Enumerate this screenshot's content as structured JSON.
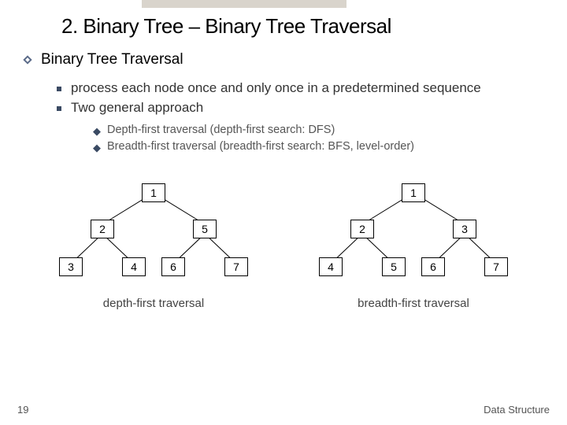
{
  "title": "2. Binary Tree – Binary Tree Traversal",
  "subtitle": "Binary Tree Traversal",
  "bullets": {
    "b1": "process each node once and only once in a predetermined sequence",
    "b2": "Two general approach"
  },
  "subbullets": {
    "s1": "Depth-first traversal (depth-first search: DFS)",
    "s2": "Breadth-first traversal (breadth-first search: BFS, level-order)"
  },
  "treeA_caption": "depth-first traversal",
  "treeB_caption": "breadth-first traversal",
  "page_number": "19",
  "footer": "Data Structure",
  "chart_data": [
    {
      "type": "tree",
      "name": "depth-first",
      "nodes": {
        "root": "1",
        "l": "2",
        "r": "5",
        "ll": "3",
        "lr": "4",
        "rl": "6",
        "rr": "7"
      },
      "edges": [
        [
          "root",
          "l"
        ],
        [
          "root",
          "r"
        ],
        [
          "l",
          "ll"
        ],
        [
          "l",
          "lr"
        ],
        [
          "r",
          "rl"
        ],
        [
          "r",
          "rr"
        ]
      ]
    },
    {
      "type": "tree",
      "name": "breadth-first",
      "nodes": {
        "root": "1",
        "l": "2",
        "r": "3",
        "ll": "4",
        "lr": "5",
        "rl": "6",
        "rr": "7"
      },
      "edges": [
        [
          "root",
          "l"
        ],
        [
          "root",
          "r"
        ],
        [
          "l",
          "ll"
        ],
        [
          "l",
          "lr"
        ],
        [
          "r",
          "rl"
        ],
        [
          "r",
          "rr"
        ]
      ]
    }
  ]
}
